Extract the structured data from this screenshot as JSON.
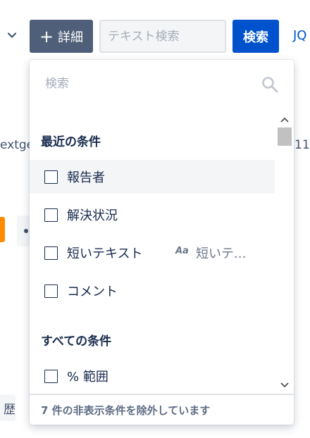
{
  "toolbar": {
    "more_label": "詳細",
    "more_icon": "plus-icon",
    "text_search_placeholder": "テキスト検索",
    "search_label": "検索",
    "jql_link": "JQ"
  },
  "background": {
    "left_fragment": "extge",
    "right_fragment": "11",
    "history_fragment": "歴"
  },
  "dropdown": {
    "search_placeholder": "検索",
    "recent_title": "最近の条件",
    "recent_items": [
      {
        "label": "報告者",
        "checked": false
      },
      {
        "label": "解決状況",
        "checked": false
      },
      {
        "label": "短いテキスト",
        "checked": false,
        "type_badge": "Aa",
        "hint": "短いテ..."
      },
      {
        "label": "コメント",
        "checked": false
      }
    ],
    "all_title": "すべての条件",
    "all_items": [
      {
        "label": "% 範囲",
        "checked": false
      }
    ],
    "footer": "7 件の非表示条件を除外しています"
  },
  "colors": {
    "primary": "#0052cc",
    "more_button": "#505f79",
    "text": "#172b4d"
  }
}
